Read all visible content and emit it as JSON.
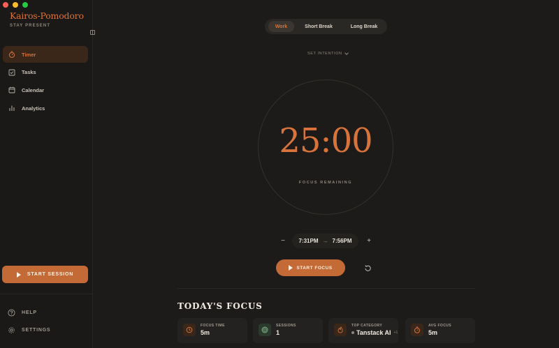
{
  "window": {
    "controls": [
      "close",
      "minimize",
      "zoom"
    ]
  },
  "app": {
    "name": "Kairos-Pomodoro",
    "tagline": "STAY PRESENT",
    "accent": "#d7733b"
  },
  "sidebar": {
    "items": [
      {
        "label": "Timer",
        "icon": "stopwatch-icon",
        "active": true
      },
      {
        "label": "Tasks",
        "icon": "checkbox-icon",
        "active": false
      },
      {
        "label": "Calendar",
        "icon": "calendar-icon",
        "active": false
      },
      {
        "label": "Analytics",
        "icon": "bar-chart-icon",
        "active": false
      }
    ],
    "start_session": "START SESSION",
    "footer": [
      {
        "label": "HELP",
        "icon": "help-icon"
      },
      {
        "label": "SETTINGS",
        "icon": "gear-icon"
      }
    ]
  },
  "modes": [
    {
      "label": "Work",
      "active": true
    },
    {
      "label": "Short Break",
      "active": false
    },
    {
      "label": "Long Break",
      "active": false
    }
  ],
  "intention": {
    "label": "SET INTENTION"
  },
  "timer": {
    "display": "25:00",
    "caption": "FOCUS REMAINING"
  },
  "range": {
    "start": "7:31PM",
    "end": "7:56PM",
    "arrow": "→",
    "minus": "−",
    "plus": "+"
  },
  "actions": {
    "start_focus": "START FOCUS"
  },
  "today": {
    "title": "TODAY'S FOCUS",
    "stats": [
      {
        "label": "FOCUS TIME",
        "value": "5m",
        "icon": "clock-icon"
      },
      {
        "label": "SESSIONS",
        "value": "1",
        "icon": "target-icon"
      },
      {
        "label": "TOP CATEGORY",
        "value": "Tanstack AI",
        "extra": "+1",
        "icon": "flame-icon"
      },
      {
        "label": "AVG FOCUS",
        "value": "5m",
        "icon": "stopwatch-icon"
      }
    ]
  }
}
